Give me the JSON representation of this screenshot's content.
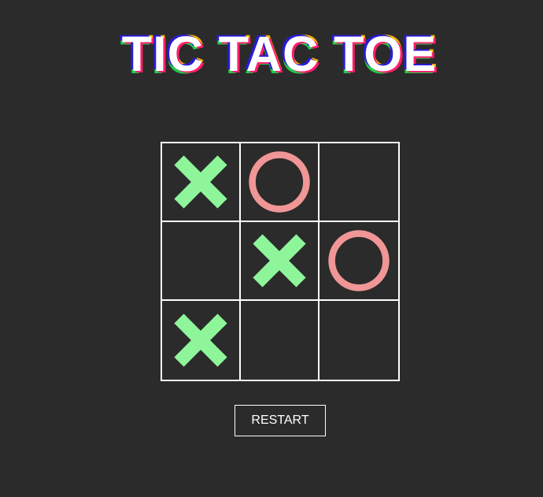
{
  "title": "TIC TAC TOE",
  "board": [
    [
      "X",
      "O",
      ""
    ],
    [
      "",
      "X",
      "O"
    ],
    [
      "X",
      "",
      ""
    ]
  ],
  "restart_label": "RESTART",
  "colors": {
    "background": "#2b2b2b",
    "x_mark": "#8ef59b",
    "o_mark": "#f09696",
    "grid": "#ffffff"
  }
}
